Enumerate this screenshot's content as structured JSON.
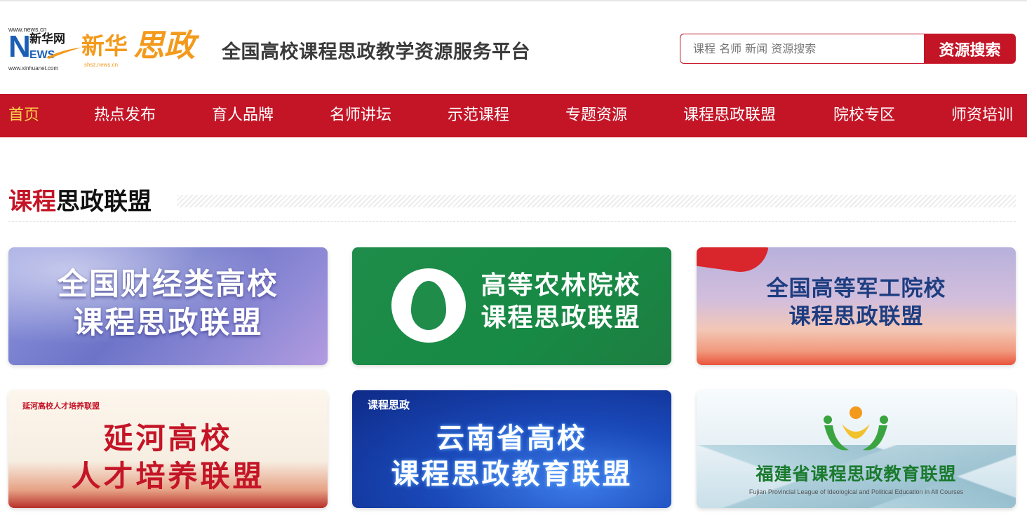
{
  "header": {
    "logo": {
      "url_top": "www.news.cn",
      "n": "N",
      "xinhua_small": "新华网",
      "ews": "EWS",
      "url_bottom": "www.xinhuanet.com",
      "brand_xinhua": "新华",
      "brand_sizheng": "思政",
      "brand_sub": "shsz.news.cn"
    },
    "site_title": "全国高校课程思政教学资源服务平台",
    "search": {
      "placeholder": "课程 名师 新闻 资源搜索",
      "value": "",
      "button_label": "资源搜索"
    }
  },
  "nav": {
    "items": [
      {
        "label": "首页",
        "active": true
      },
      {
        "label": "热点发布"
      },
      {
        "label": "育人品牌"
      },
      {
        "label": "名师讲坛"
      },
      {
        "label": "示范课程"
      },
      {
        "label": "专题资源"
      },
      {
        "label": "课程思政联盟"
      },
      {
        "label": "院校专区"
      },
      {
        "label": "师资培训"
      }
    ]
  },
  "section": {
    "title_red": "课程",
    "title_black": "思政联盟"
  },
  "cards": [
    {
      "line1": "全国财经类高校",
      "line2": "课程思政联盟"
    },
    {
      "line1": "高等农林院校",
      "line2": "课程思政联盟"
    },
    {
      "line1": "全国高等军工院校",
      "line2": "课程思政联盟"
    },
    {
      "badge": "延河高校人才培养联盟",
      "line1": "延河高校",
      "line2": "人才培养联盟"
    },
    {
      "badge": "课程思政",
      "line1": "云南省高校",
      "line2": "课程思政教育联盟"
    },
    {
      "line1": "福建省课程思政教育联盟",
      "sub": "Fujian Provincial League of Ideological and Political Education in All Courses"
    }
  ],
  "colors": {
    "brand_red": "#c41527",
    "nav_active": "#ffd24a",
    "logo_orange": "#f39a1c",
    "logo_blue": "#1a5fb4"
  }
}
